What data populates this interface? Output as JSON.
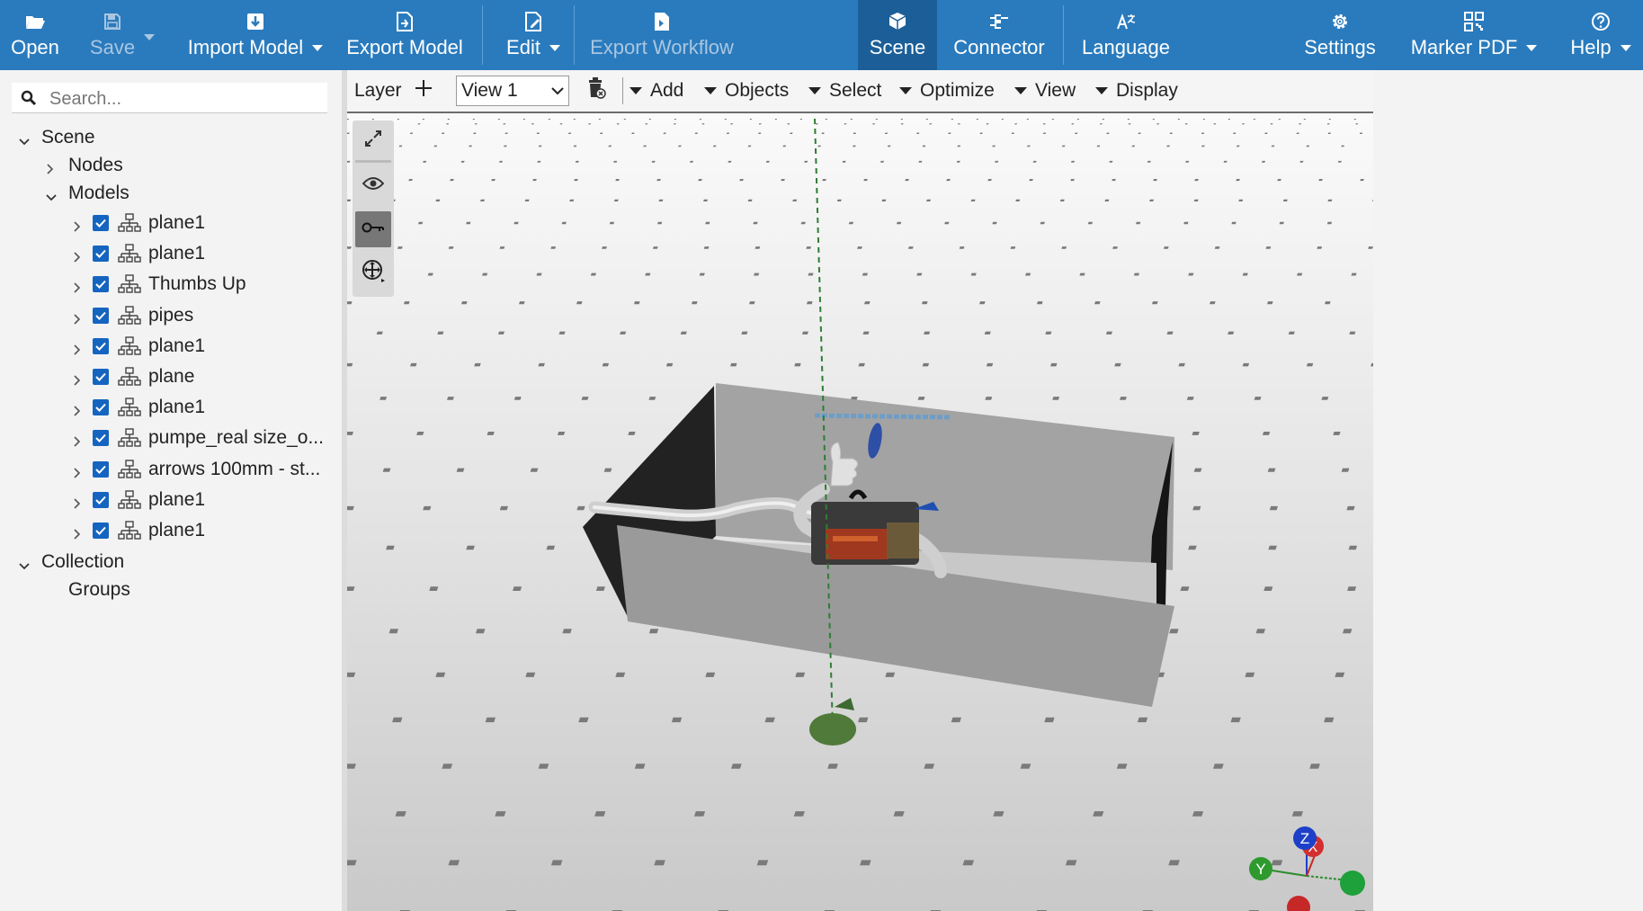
{
  "toolbar": {
    "open": "Open",
    "save": "Save",
    "import_model": "Import Model",
    "export_model": "Export Model",
    "edit": "Edit",
    "export_workflow": "Export Workflow",
    "scene": "Scene",
    "connector": "Connector",
    "language": "Language",
    "settings": "Settings",
    "marker_pdf": "Marker PDF",
    "help": "Help",
    "icons": [
      "folder-open-icon",
      "save-icon",
      "import-icon",
      "export-icon",
      "edit-icon",
      "workflow-icon",
      "scene-icon",
      "connector-icon",
      "language-icon",
      "gear-icon",
      "qr-code-icon",
      "help-icon"
    ],
    "active_tab": "Scene"
  },
  "sidebar": {
    "search_placeholder": "Search...",
    "scene": "Scene",
    "nodes": "Nodes",
    "models_label": "Models",
    "models": [
      {
        "label": "plane1",
        "checked": true
      },
      {
        "label": "plane1",
        "checked": true
      },
      {
        "label": "Thumbs Up",
        "checked": true
      },
      {
        "label": "pipes",
        "checked": true
      },
      {
        "label": "plane1",
        "checked": true
      },
      {
        "label": "plane",
        "checked": true
      },
      {
        "label": "plane1",
        "checked": true
      },
      {
        "label": "pumpe_real size_o...",
        "checked": true
      },
      {
        "label": "arrows 100mm - st...",
        "checked": true
      },
      {
        "label": "plane1",
        "checked": true
      },
      {
        "label": "plane1",
        "checked": true
      }
    ],
    "collection": "Collection",
    "groups": "Groups"
  },
  "viewbar": {
    "layer": "Layer",
    "view_value": "View 1",
    "add": "Add",
    "objects": "Objects",
    "select": "Select",
    "optimize": "Optimize",
    "view": "View",
    "display": "Display"
  },
  "gizmo": {
    "x": "X",
    "y": "Y",
    "z": "Z"
  },
  "colors": {
    "toolbar_bg": "#2a7bbd",
    "toolbar_active": "#1c5f98",
    "checkbox": "#1565c0",
    "axis_green": "#2e7d32"
  }
}
